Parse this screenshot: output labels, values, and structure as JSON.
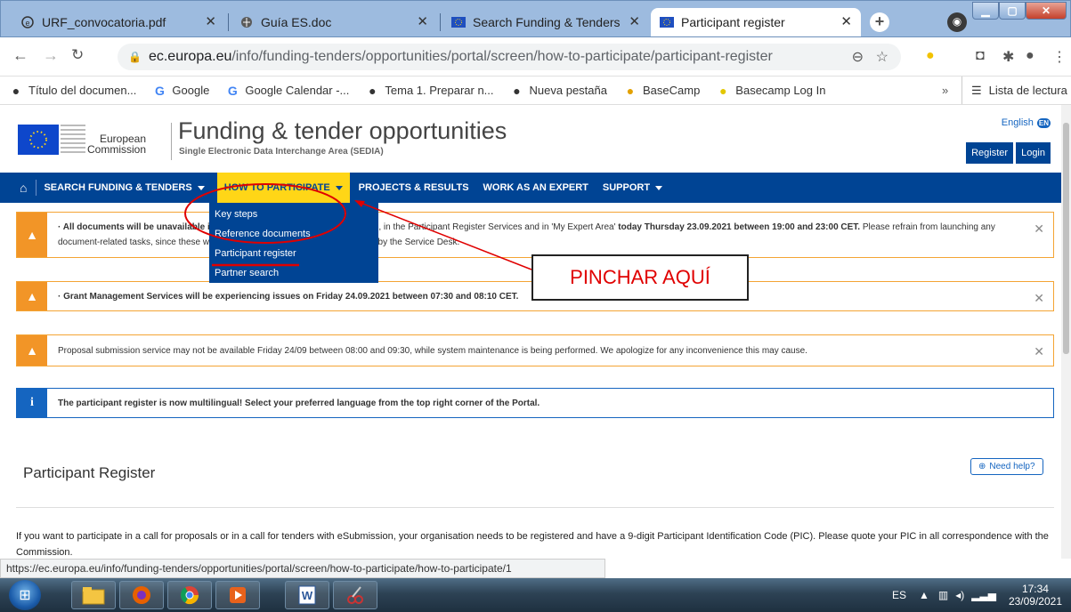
{
  "browser": {
    "tabs": [
      {
        "title": "URF_convocatoria.pdf",
        "icon": "pdf-icon",
        "active": false
      },
      {
        "title": "Guía ES.doc",
        "icon": "globe-icon",
        "active": false
      },
      {
        "title": "Search Funding & Tenders",
        "icon": "eu-flag-icon",
        "active": false
      },
      {
        "title": "Participant register",
        "icon": "eu-flag-icon",
        "active": true
      }
    ],
    "new_tab": "+",
    "url_domain": "ec.europa.eu",
    "url_path": "/info/funding-tenders/opportunities/portal/screen/how-to-participate/participant-register",
    "bookmarks": [
      {
        "label": "Título del documen...",
        "icon": "globe-icon"
      },
      {
        "label": "Google",
        "icon": "google-icon"
      },
      {
        "label": "Google Calendar -...",
        "icon": "google-icon"
      },
      {
        "label": "Tema 1. Preparar n...",
        "icon": "globe-icon"
      },
      {
        "label": "Nueva pestaña",
        "icon": "globe-icon"
      },
      {
        "label": "BaseCamp",
        "icon": "basecamp-icon"
      },
      {
        "label": "Basecamp Log In",
        "icon": "basecamp-icon"
      }
    ],
    "bookmarks_more": "»",
    "reading_list": "Lista de lectura",
    "status_url": "https://ec.europa.eu/info/funding-tenders/opportunities/portal/screen/how-to-participate/how-to-participate/1"
  },
  "site": {
    "logo_line1": "European",
    "logo_line2": "Commission",
    "title": "Funding & tender opportunities",
    "subtitle": "Single Electronic Data Interchange Area (SEDIA)",
    "language": "English",
    "language_code": "EN",
    "register": "Register",
    "login": "Login",
    "nav": [
      {
        "label": "SEARCH FUNDING & TENDERS",
        "dropdown": true,
        "active": false
      },
      {
        "label": "HOW TO PARTICIPATE",
        "dropdown": true,
        "active": true
      },
      {
        "label": "PROJECTS & RESULTS",
        "dropdown": false,
        "active": false
      },
      {
        "label": "WORK AS AN EXPERT",
        "dropdown": false,
        "active": false
      },
      {
        "label": "SUPPORT",
        "dropdown": true,
        "active": false
      }
    ],
    "dropdown_items": [
      "Key steps",
      "Reference documents",
      "Participant register",
      "Partner search"
    ]
  },
  "alerts": [
    {
      "type": "warning",
      "text_bold": "· All documents will be unavailable i",
      "text_mid": "ces, in the Participant Register Services and in 'My Expert Area' ",
      "text_bold2": "today Thursday 23.09.2021 between 19:00 and 23:00 CET.",
      "text_tail": " Please refrain from launching any",
      "text_line2a": "document-related tasks, since these w",
      "text_line2b": "restored by the Service Desk."
    },
    {
      "type": "warning",
      "text": "· Grant Management Services will be experiencing issues on Friday 24.09.2021 between 07:30 and 08:10 CET."
    },
    {
      "type": "warning",
      "text": "Proposal submission service may not be available Friday 24/09 between 08:00 and 09:30, while system maintenance is being performed. We apologize for any inconvenience this may cause."
    },
    {
      "type": "info",
      "text": "The participant register is now multilingual! Select your preferred language from the top right corner of the Portal."
    }
  ],
  "content": {
    "heading": "Participant Register",
    "need_help": "Need help?",
    "intro": "If you want to participate in a call for proposals or in a call for tenders with eSubmission, your organisation needs to be registered and have a 9-digit Participant Identification Code (PIC). Please quote your PIC in all correspondence with the Commission."
  },
  "annotation": {
    "label": "PINCHAR AQUÍ",
    "color": "#e00000"
  },
  "taskbar": {
    "lang": "ES",
    "time": "17:34",
    "date": "23/09/2021"
  }
}
